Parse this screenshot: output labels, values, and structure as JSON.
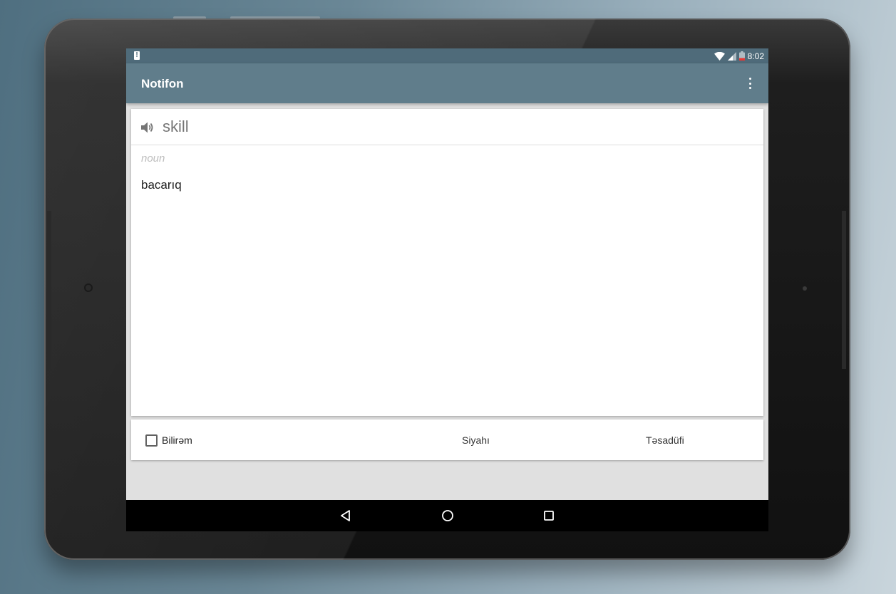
{
  "status_bar": {
    "time": "8:02",
    "icons": [
      "alert-icon",
      "wifi-icon",
      "signal-icon",
      "battery-icon"
    ]
  },
  "app_bar": {
    "title": "Notifon",
    "menu_icon": "overflow-menu-icon"
  },
  "card": {
    "word": "skill",
    "part_of_speech": "noun",
    "translation": "bacarıq",
    "speaker_icon": "speaker-icon"
  },
  "bottom_bar": {
    "know_label": "Bilirəm",
    "know_checked": false,
    "list_label": "Siyahı",
    "random_label": "Təsadüfi"
  },
  "nav_bar": {
    "icons": [
      "back-icon",
      "home-icon",
      "recents-icon"
    ]
  },
  "colors": {
    "primary": "#607d8b",
    "status_bar": "#4f6b7a",
    "screen_background": "#e0e0e0",
    "card_background": "#ffffff"
  }
}
